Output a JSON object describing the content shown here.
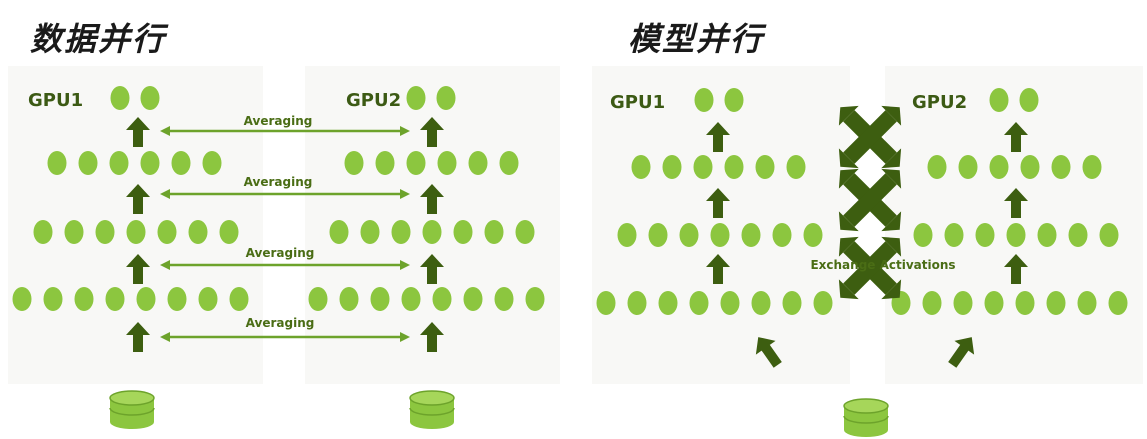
{
  "data_parallel": {
    "title": "数据并行",
    "gpu_labels": [
      "GPU1",
      "GPU2"
    ],
    "averaging_labels": [
      "Averaging",
      "Averaging",
      "Averaging",
      "Averaging"
    ]
  },
  "model_parallel": {
    "title": "模型并行",
    "gpu_labels": [
      "GPU1",
      "GPU2"
    ],
    "exchange_label": "Exchange Activations"
  },
  "colors": {
    "node": "#8cc63f",
    "arrow": "#3d5e10",
    "connector": "#6da32b",
    "database": "#8cc63f"
  }
}
